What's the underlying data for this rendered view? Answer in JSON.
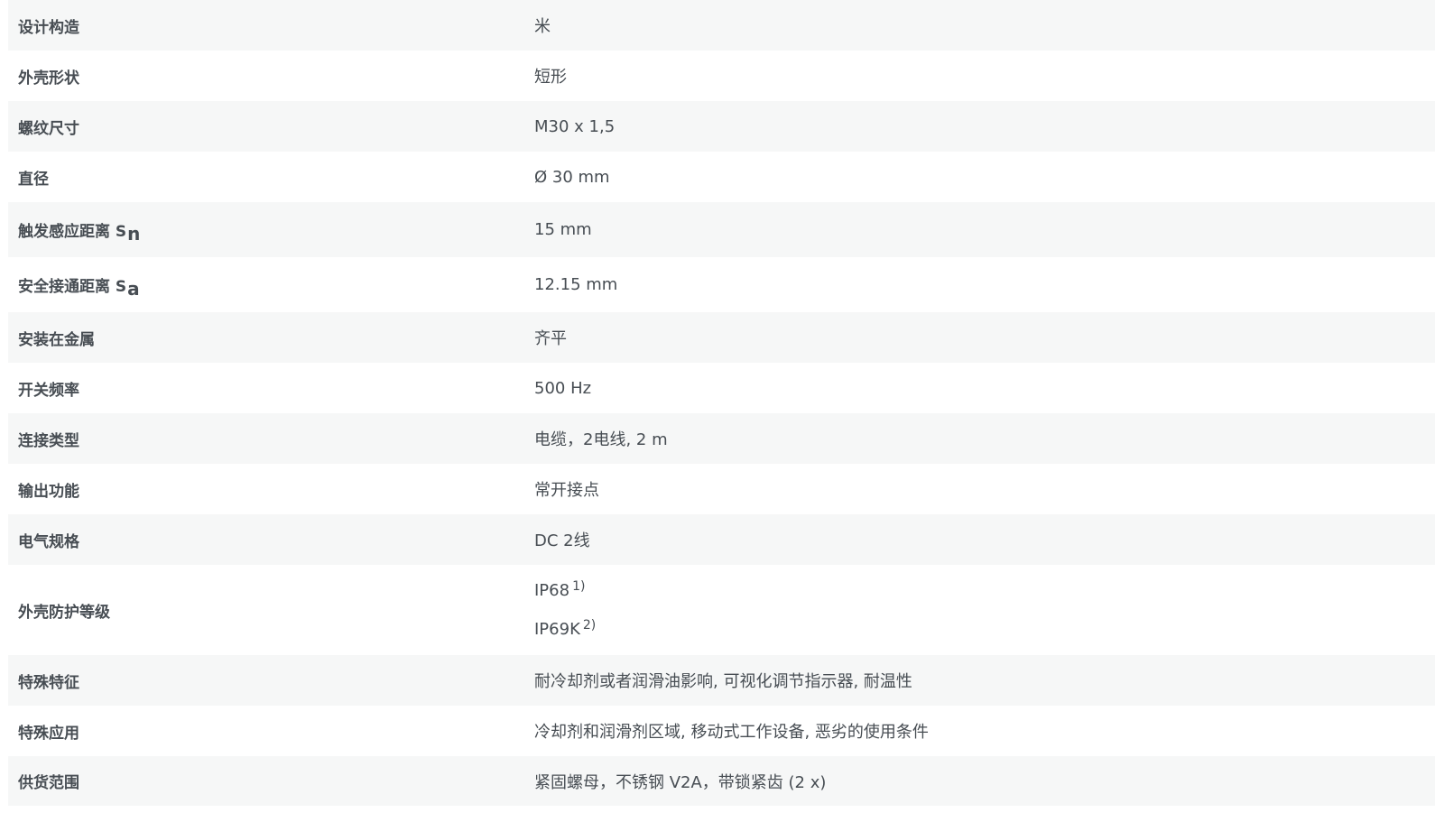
{
  "rows": [
    {
      "label": "设计构造",
      "value": "米"
    },
    {
      "label": "外壳形状",
      "value": "短形"
    },
    {
      "label": "螺纹尺寸",
      "value": "M30 x 1,5"
    },
    {
      "label": "直径",
      "value": "Ø 30 mm"
    },
    {
      "label": "触发感应距离 S",
      "label_sub": "n",
      "value": "15 mm"
    },
    {
      "label": "安全接通距离 S",
      "label_sub": "a",
      "value": "12.15 mm"
    },
    {
      "label": "安装在金属",
      "value": "齐平"
    },
    {
      "label": "开关频率",
      "value": "500 Hz"
    },
    {
      "label": "连接类型",
      "value": "电缆，2电线, 2 m"
    },
    {
      "label": "输出功能",
      "value": "常开接点"
    },
    {
      "label": "电气规格",
      "value": "DC 2线"
    },
    {
      "label": "外壳防护等级",
      "values": [
        {
          "text": "IP68",
          "note": "1)"
        },
        {
          "text": "IP69K",
          "note": "2)"
        }
      ]
    },
    {
      "label": "特殊特征",
      "value": "耐冷却剂或者润滑油影响, 可视化调节指示器, 耐温性"
    },
    {
      "label": "特殊应用",
      "value": "冷却剂和润滑剂区域, 移动式工作设备, 恶劣的使用条件"
    },
    {
      "label": "供货范围",
      "value": "紧固螺母，不锈钢 V2A，带锁紧齿 (2 x)"
    }
  ]
}
